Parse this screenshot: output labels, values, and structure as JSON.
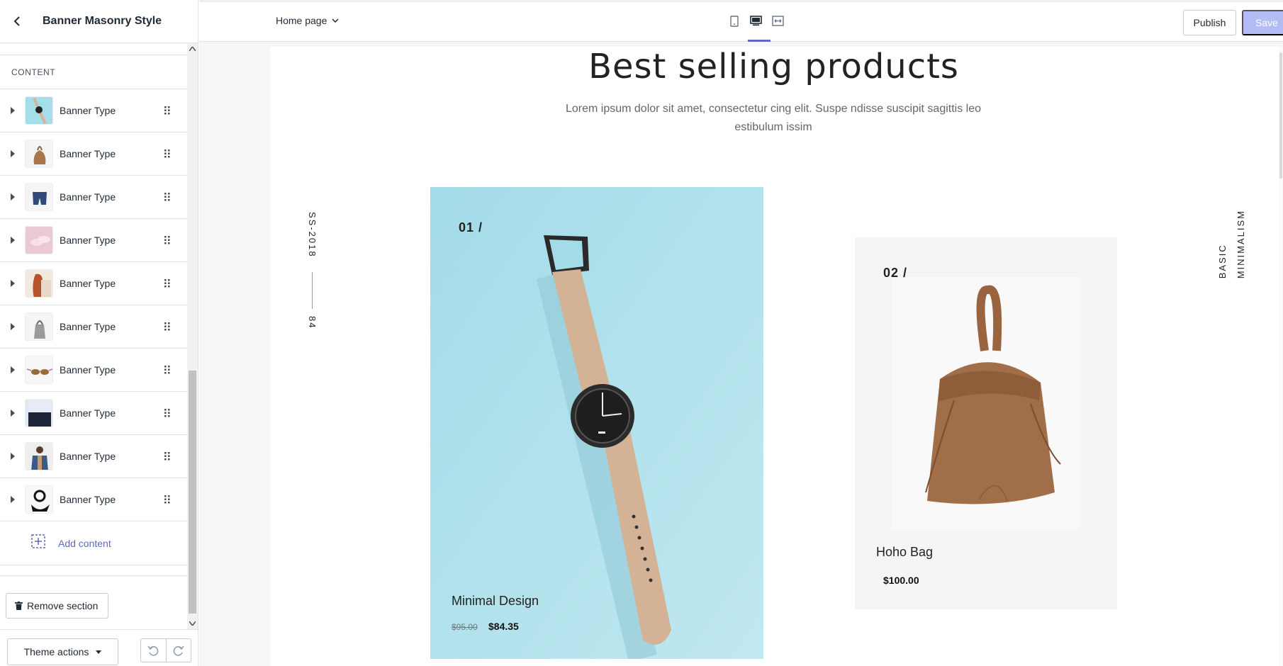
{
  "sidebar": {
    "title": "Banner Masonry Style",
    "section_label": "CONTENT",
    "blocks": [
      {
        "label": "Banner Type",
        "thumb": "watch"
      },
      {
        "label": "Banner Type",
        "thumb": "bag"
      },
      {
        "label": "Banner Type",
        "thumb": "shorts"
      },
      {
        "label": "Banner Type",
        "thumb": "slippers"
      },
      {
        "label": "Banner Type",
        "thumb": "model-red-hair"
      },
      {
        "label": "Banner Type",
        "thumb": "grey-bag"
      },
      {
        "label": "Banner Type",
        "thumb": "sunglasses"
      },
      {
        "label": "Banner Type",
        "thumb": "navy-pants"
      },
      {
        "label": "Banner Type",
        "thumb": "denim-jacket"
      },
      {
        "label": "Banner Type",
        "thumb": "black-watch"
      }
    ],
    "add_content": "Add content",
    "remove_section": "Remove section",
    "theme_actions": "Theme actions"
  },
  "topbar": {
    "page_select": "Home page",
    "publish": "Publish",
    "save": "Save",
    "devices": [
      "mobile-icon",
      "desktop-icon",
      "fullwidth-icon"
    ],
    "active_device": "desktop-icon",
    "accent": "#5c6ac4"
  },
  "preview": {
    "heading": "Best selling products",
    "subtext": "Lorem ipsum dolor sit amet, consectetur cing elit. Suspe ndisse suscipit sagittis leo estibulum issim",
    "left_vertical": "SS-2018",
    "left_number": "84",
    "right_vertical_1": "BASIC",
    "right_vertical_2": "MINIMALISM",
    "products": [
      {
        "num": "01 /",
        "name": "Minimal Design",
        "old_price": "$95.00",
        "price": "$84.35",
        "bg": "#a5dde9"
      },
      {
        "num": "02 /",
        "name": "Hoho Bag",
        "price": "$100.00",
        "bg": "#f5f5f5"
      }
    ]
  }
}
